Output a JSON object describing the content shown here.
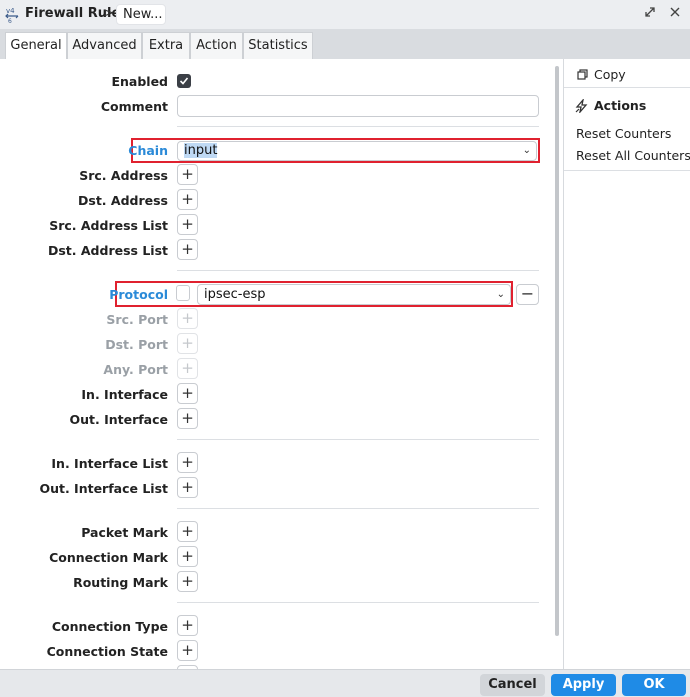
{
  "window": {
    "title": "Firewall Rule",
    "crumb_sep": ">",
    "crumb_current": "New..."
  },
  "tabs": [
    {
      "label": "General"
    },
    {
      "label": "Advanced"
    },
    {
      "label": "Extra"
    },
    {
      "label": "Action"
    },
    {
      "label": "Statistics"
    }
  ],
  "form": {
    "enabled_label": "Enabled",
    "enabled_checked": true,
    "comment_label": "Comment",
    "comment_value": "",
    "chain_label": "Chain",
    "chain_value": "input",
    "src_address_label": "Src. Address",
    "dst_address_label": "Dst. Address",
    "src_address_list_label": "Src. Address List",
    "dst_address_list_label": "Dst. Address List",
    "protocol_label": "Protocol",
    "protocol_value": "ipsec-esp",
    "src_port_label": "Src. Port",
    "dst_port_label": "Dst. Port",
    "any_port_label": "Any. Port",
    "in_interface_label": "In. Interface",
    "out_interface_label": "Out. Interface",
    "in_interface_list_label": "In. Interface List",
    "out_interface_list_label": "Out. Interface List",
    "packet_mark_label": "Packet Mark",
    "connection_mark_label": "Connection Mark",
    "routing_mark_label": "Routing Mark",
    "connection_type_label": "Connection Type",
    "connection_state_label": "Connection State",
    "plus_glyph": "+",
    "minus_glyph": "−"
  },
  "side_panel": {
    "copy_label": "Copy",
    "actions_label": "Actions",
    "reset_counters_label": "Reset Counters",
    "reset_all_counters_label": "Reset All Counters"
  },
  "buttons": {
    "cancel": "Cancel",
    "apply": "Apply",
    "ok": "OK"
  },
  "colors": {
    "accent": "#1f8be6",
    "highlight_box": "#e0212f",
    "link_label": "#2a8ad8"
  }
}
